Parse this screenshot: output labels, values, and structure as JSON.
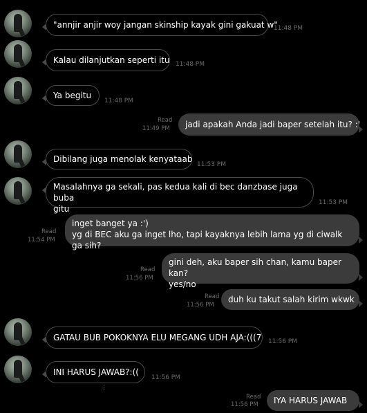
{
  "messages": [
    {
      "dir": "in",
      "text": "\"annjir anjir woy jangan skinship kayak gini gakuat w\"",
      "time": "11:48 PM"
    },
    {
      "dir": "in",
      "text": "Kalau dilanjutkan seperti itu",
      "time": "11:48 PM"
    },
    {
      "dir": "in",
      "text": "Ya begitu",
      "time": "11:48 PM"
    },
    {
      "dir": "out",
      "text": "jadi apakah Anda jadi baper setelah itu? :'",
      "read": "Read",
      "time": "11:49 PM"
    },
    {
      "dir": "in",
      "text": "Dibilang juga menolak kenyataab",
      "time": "11:53 PM"
    },
    {
      "dir": "in",
      "line1": "Masalahnya ga sekali, pas kedua kali di bec danzbase juga buba",
      "line2": "gitu",
      "time": "11:53 PM"
    },
    {
      "dir": "out",
      "line1": "inget banget ya :')",
      "line2": "yg di BEC aku ga inget lho, tapi kayaknya lebih lama yg di ciwalk ga sih?",
      "read": "Read",
      "time": "11:54 PM"
    },
    {
      "dir": "out",
      "line1": "gini deh, aku baper sih chan, kamu baper kan?",
      "line2": "yes/no",
      "read": "Read",
      "time": "11:56 PM"
    },
    {
      "dir": "out",
      "text": "duh ku takut salah kirim wkwk",
      "read": "Read",
      "time": "11:56 PM"
    },
    {
      "dir": "in",
      "text": "GATAU BUB POKOKNYA ELU MEGANG UDH AJA:(((7",
      "time": "11:56 PM"
    },
    {
      "dir": "in",
      "text": "INI HARUS JAWAB?:((",
      "time": "11:56 PM"
    },
    {
      "dir": "out",
      "text": "IYA HARUS JAWAB",
      "read": "Read",
      "time": "11:56 PM"
    }
  ],
  "icons": {
    "avatar": "contact-avatar",
    "scroll": "scroll-indicator-icon"
  }
}
